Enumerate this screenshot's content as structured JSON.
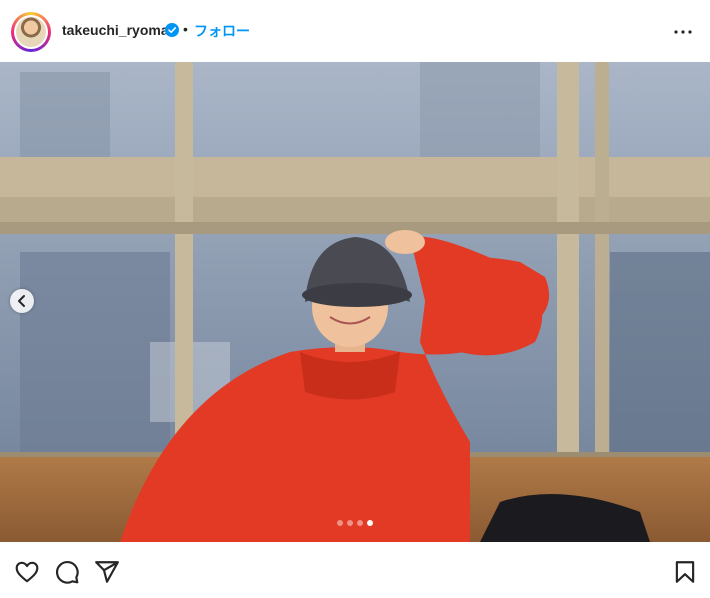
{
  "header": {
    "username": "takeuchi_ryoma",
    "separator": "•",
    "follow_label": "フォロー"
  },
  "icons": {
    "avatar": "avatar",
    "verified": "verified-badge-icon",
    "more": "more-options-icon",
    "prev": "chevron-left-icon",
    "like": "heart-icon",
    "comment": "comment-icon",
    "share": "share-icon",
    "save": "bookmark-icon"
  },
  "carousel": {
    "total_slides": 4,
    "active_index": 3
  },
  "colors": {
    "accent": "#0095f6",
    "text": "#262626",
    "hoodie": "#e23a25"
  }
}
